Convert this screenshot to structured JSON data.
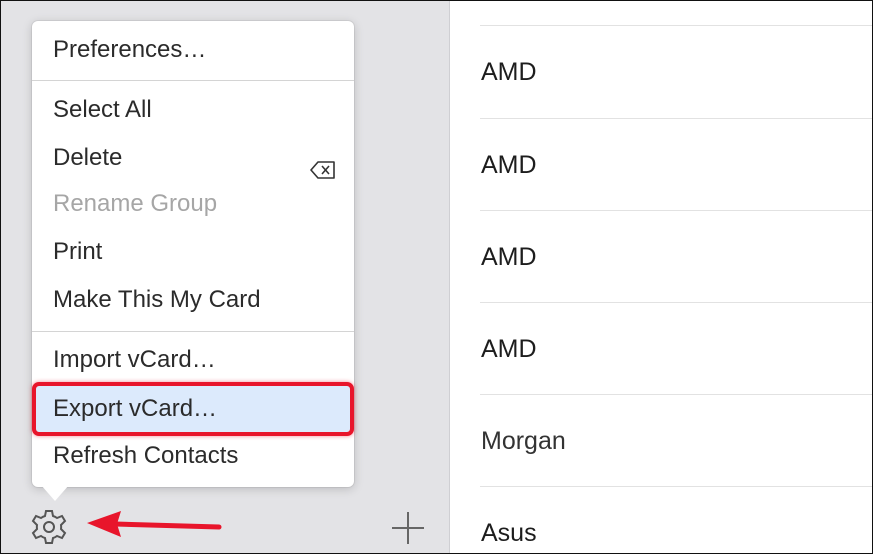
{
  "menu": {
    "items": [
      {
        "label": "Preferences…",
        "enabled": true
      },
      {
        "label": "Select All",
        "enabled": true
      },
      {
        "label": "Delete",
        "enabled": true,
        "shortcut_icon": "delete-key-icon"
      },
      {
        "label": "Rename Group",
        "enabled": false
      },
      {
        "label": "Print",
        "enabled": true
      },
      {
        "label": "Make This My Card",
        "enabled": true
      },
      {
        "label": "Import vCard…",
        "enabled": true
      },
      {
        "label": "Export vCard…",
        "enabled": true,
        "highlighted": true
      },
      {
        "label": "Refresh Contacts",
        "enabled": true
      }
    ]
  },
  "sidebar": {
    "bottom_icons": [
      "gear-icon",
      "plus-icon"
    ]
  },
  "contacts": [
    {
      "name": "AMD"
    },
    {
      "name": "AMD"
    },
    {
      "name": "AMD"
    },
    {
      "name": "AMD"
    },
    {
      "name": "Morgan"
    },
    {
      "name": "Asus"
    }
  ],
  "colors": {
    "highlight_border": "#e8152b",
    "highlight_fill": "#dceafc",
    "arrow": "#e8152b",
    "disabled_text": "#a6a6a6"
  }
}
